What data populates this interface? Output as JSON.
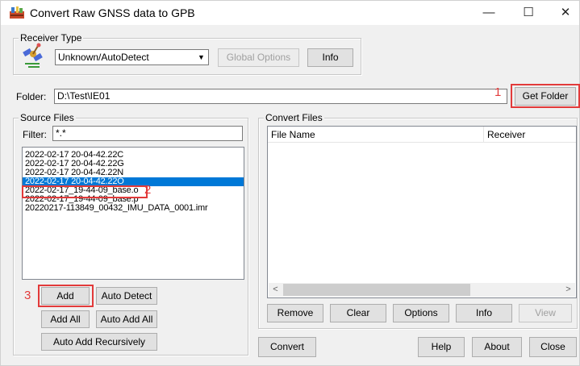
{
  "window": {
    "title": "Convert Raw GNSS data to GPB",
    "minimize": "—",
    "maximize": "☐",
    "close": "✕"
  },
  "receiver": {
    "legend": "Receiver Type",
    "selected": "Unknown/AutoDetect",
    "global_options": "Global Options",
    "info": "Info"
  },
  "folder": {
    "label": "Folder:",
    "value": "D:\\Test\\IE01",
    "get_folder": "Get Folder"
  },
  "source": {
    "legend": "Source Files",
    "filter_label": "Filter:",
    "filter_value": "*.*",
    "files": [
      "2022-02-17 20-04-42.22C",
      "2022-02-17 20-04-42.22G",
      "2022-02-17 20-04-42.22N",
      "2022-02-17 20-04-42.22O",
      "2022-02-17_19-44-09_base.o",
      "2022-02-17_19-44-09_base.p",
      "20220217-113849_00432_IMU_DATA_0001.imr"
    ],
    "selected_index": 3,
    "add": "Add",
    "auto_detect": "Auto Detect",
    "add_all": "Add All",
    "auto_add_all": "Auto Add All",
    "auto_add_recursively": "Auto Add Recursively"
  },
  "convert": {
    "legend": "Convert Files",
    "col_file_name": "File Name",
    "col_receiver": "Receiver",
    "remove": "Remove",
    "clear": "Clear",
    "options": "Options",
    "info": "Info",
    "view": "View"
  },
  "bottom": {
    "convert": "Convert",
    "help": "Help",
    "about": "About",
    "close": "Close"
  },
  "annotations": {
    "step1": "1",
    "step2": "2",
    "step3": "3",
    "color": "#e23a3a"
  },
  "colors": {
    "selection": "#0078d7",
    "face": "#f0f0f0"
  }
}
